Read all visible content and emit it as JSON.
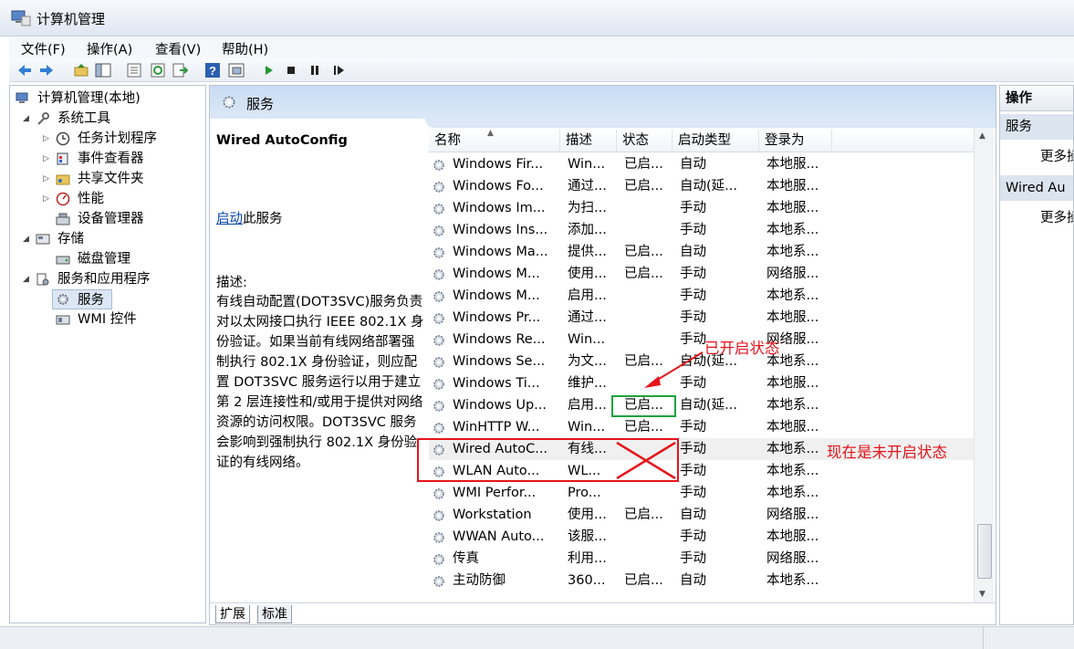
{
  "window": {
    "title": "计算机管理"
  },
  "menu": [
    "文件(F)",
    "操作(A)",
    "查看(V)",
    "帮助(H)"
  ],
  "toolbar": {
    "icons": [
      "back-icon",
      "forward-icon",
      "up-folder-icon",
      "show-tree-icon",
      "export-icon",
      "refresh-icon",
      "export-list-icon",
      "help-icon",
      "properties-icon",
      "play-icon",
      "stop-icon",
      "pause-icon",
      "resume-icon"
    ]
  },
  "tree": {
    "root": "计算机管理(本地)",
    "system_tools": "系统工具",
    "task_scheduler": "任务计划程序",
    "event_viewer": "事件查看器",
    "shared_folders": "共享文件夹",
    "performance": "性能",
    "device_manager": "设备管理器",
    "storage": "存储",
    "disk_management": "磁盘管理",
    "services_apps": "服务和应用程序",
    "services": "服务",
    "wmi": "WMI 控件"
  },
  "panel": {
    "title": "服务"
  },
  "detail": {
    "service_name": "Wired AutoConfig",
    "start_link": "启动",
    "start_suffix": "此服务",
    "desc_label": "描述:",
    "desc_text": "有线自动配置(DOT3SVC)服务负责对以太网接口执行 IEEE 802.1X 身份验证。如果当前有线网络部署强制执行 802.1X 身份验证，则应配置 DOT3SVC 服务运行以用于建立第 2 层连接性和/或用于提供对网络资源的访问权限。DOT3SVC 服务会影响到强制执行 802.1X 身份验证的有线网络。"
  },
  "columns": [
    "名称",
    "描述",
    "状态",
    "启动类型",
    "登录为"
  ],
  "services": [
    {
      "name": "Windows Fir...",
      "desc": "Win...",
      "status": "已启...",
      "startup": "自动",
      "logon": "本地服..."
    },
    {
      "name": "Windows Fo...",
      "desc": "通过...",
      "status": "已启...",
      "startup": "自动(延...",
      "logon": "本地服..."
    },
    {
      "name": "Windows Im...",
      "desc": "为扫...",
      "status": "",
      "startup": "手动",
      "logon": "本地服..."
    },
    {
      "name": "Windows Ins...",
      "desc": "添加...",
      "status": "",
      "startup": "手动",
      "logon": "本地系..."
    },
    {
      "name": "Windows Ma...",
      "desc": "提供...",
      "status": "已启...",
      "startup": "自动",
      "logon": "本地系..."
    },
    {
      "name": "Windows M...",
      "desc": "使用...",
      "status": "已启...",
      "startup": "手动",
      "logon": "网络服..."
    },
    {
      "name": "Windows M...",
      "desc": "启用...",
      "status": "",
      "startup": "手动",
      "logon": "本地系..."
    },
    {
      "name": "Windows Pr...",
      "desc": "通过...",
      "status": "",
      "startup": "手动",
      "logon": "本地服..."
    },
    {
      "name": "Windows Re...",
      "desc": "Win...",
      "status": "",
      "startup": "手动",
      "logon": "网络服..."
    },
    {
      "name": "Windows Se...",
      "desc": "为文...",
      "status": "已启...",
      "startup": "自动(延...",
      "logon": "本地系..."
    },
    {
      "name": "Windows Ti...",
      "desc": "维护...",
      "status": "",
      "startup": "手动",
      "logon": "本地服..."
    },
    {
      "name": "Windows Up...",
      "desc": "启用...",
      "status": "已启...",
      "startup": "自动(延...",
      "logon": "本地系..."
    },
    {
      "name": "WinHTTP W...",
      "desc": "Win...",
      "status": "已启...",
      "startup": "手动",
      "logon": "本地服..."
    },
    {
      "name": "Wired AutoC...",
      "desc": "有线...",
      "status": "",
      "startup": "手动",
      "logon": "本地系..."
    },
    {
      "name": "WLAN Auto...",
      "desc": "WL...",
      "status": "",
      "startup": "手动",
      "logon": "本地系..."
    },
    {
      "name": "WMI Perfor...",
      "desc": "Pro...",
      "status": "",
      "startup": "手动",
      "logon": "本地系..."
    },
    {
      "name": "Workstation",
      "desc": "使用...",
      "status": "已启...",
      "startup": "自动",
      "logon": "网络服..."
    },
    {
      "name": "WWAN Auto...",
      "desc": "该服...",
      "status": "",
      "startup": "手动",
      "logon": "本地服..."
    },
    {
      "name": "传真",
      "desc": "利用...",
      "status": "",
      "startup": "手动",
      "logon": "网络服..."
    },
    {
      "name": "主动防御",
      "desc": "360...",
      "status": "已启...",
      "startup": "自动",
      "logon": "本地系..."
    }
  ],
  "selected_index": 13,
  "tabs": [
    "扩展",
    "标准"
  ],
  "actions": {
    "header": "操作",
    "group1": "服务",
    "more1": "更多操",
    "group2": "Wired Au",
    "more2": "更多操"
  },
  "annotations": {
    "started_label": "已开启状态",
    "not_started_label": "现在是未开启状态",
    "red_color": "#e5141b",
    "green_color": "#1aa33c"
  }
}
